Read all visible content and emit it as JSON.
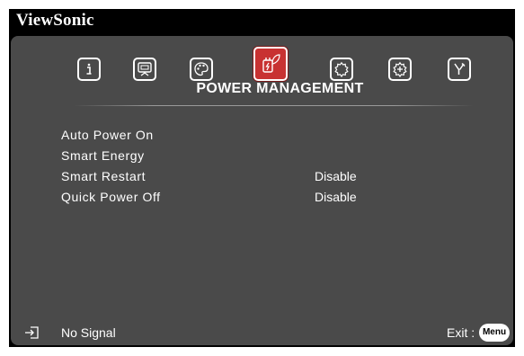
{
  "brand": {
    "name": "ViewSonic"
  },
  "tabs": [
    {
      "name": "information-icon",
      "active": false
    },
    {
      "name": "display-icon",
      "active": false
    },
    {
      "name": "image-palette-icon",
      "active": false
    },
    {
      "name": "power-leaf-icon",
      "active": true
    },
    {
      "name": "settings-gear-icon",
      "active": false
    },
    {
      "name": "advanced-gear-icon",
      "active": false
    },
    {
      "name": "tools-icon",
      "active": false
    }
  ],
  "section": {
    "title": "POWER MANAGEMENT"
  },
  "menu": {
    "items": [
      {
        "label": "Auto Power On",
        "value": ""
      },
      {
        "label": "Smart Energy",
        "value": ""
      },
      {
        "label": "Smart Restart",
        "value": "Disable"
      },
      {
        "label": "Quick Power Off",
        "value": "Disable"
      }
    ]
  },
  "footer": {
    "input_icon": "input-source-icon",
    "signal": "No Signal",
    "exit_label": "Exit :",
    "menu_badge": "Menu"
  },
  "colors": {
    "panel": "#4a4a4a",
    "active_tab": "#c83232",
    "frame": "#000000"
  }
}
